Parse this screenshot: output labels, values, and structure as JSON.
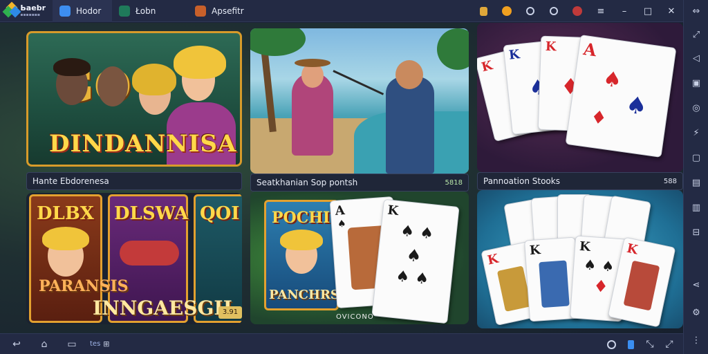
{
  "window": {
    "tabs": [
      {
        "label": "Ьaebr",
        "sublabel": "▪▪▪▪▪▪▪",
        "icon": "diamond-logo-icon",
        "active": false
      },
      {
        "label": "Hodor",
        "icon": "chat-app-icon",
        "active": true
      },
      {
        "label": "Łobn",
        "icon": "game-icon",
        "active": false
      },
      {
        "label": "Apsefitr",
        "icon": "game-icon",
        "active": false
      }
    ],
    "controls": {
      "minimize": "–",
      "maximize": "□",
      "close": "✕"
    }
  },
  "games": [
    {
      "caption": "Hante Ebdorenesa",
      "count": "",
      "art_title": "DINDANNISA",
      "art_letters": "GO"
    },
    {
      "caption": "Seatkhanian Sop pontsh",
      "count": "5818"
    },
    {
      "caption": "Pannoation Stooks",
      "count": "588"
    }
  ],
  "bottom_games": [
    {
      "slot_titles": [
        "DLBX",
        "DLSWA",
        "QOI"
      ],
      "promo": "INNGAESGH",
      "sub": "PARANSIS",
      "badge": "3.91"
    },
    {
      "slot_titles": [
        "POCHI"
      ],
      "promo": "PANCHRS",
      "sub": "OVICONO"
    },
    {
      "cards": [
        "K",
        "K",
        "K",
        "K"
      ]
    }
  ],
  "bottombar": {
    "label": "tes"
  },
  "colors": {
    "accent": "#d89b2a",
    "bar": "#232a44",
    "count_green": "#b8e6a8"
  }
}
